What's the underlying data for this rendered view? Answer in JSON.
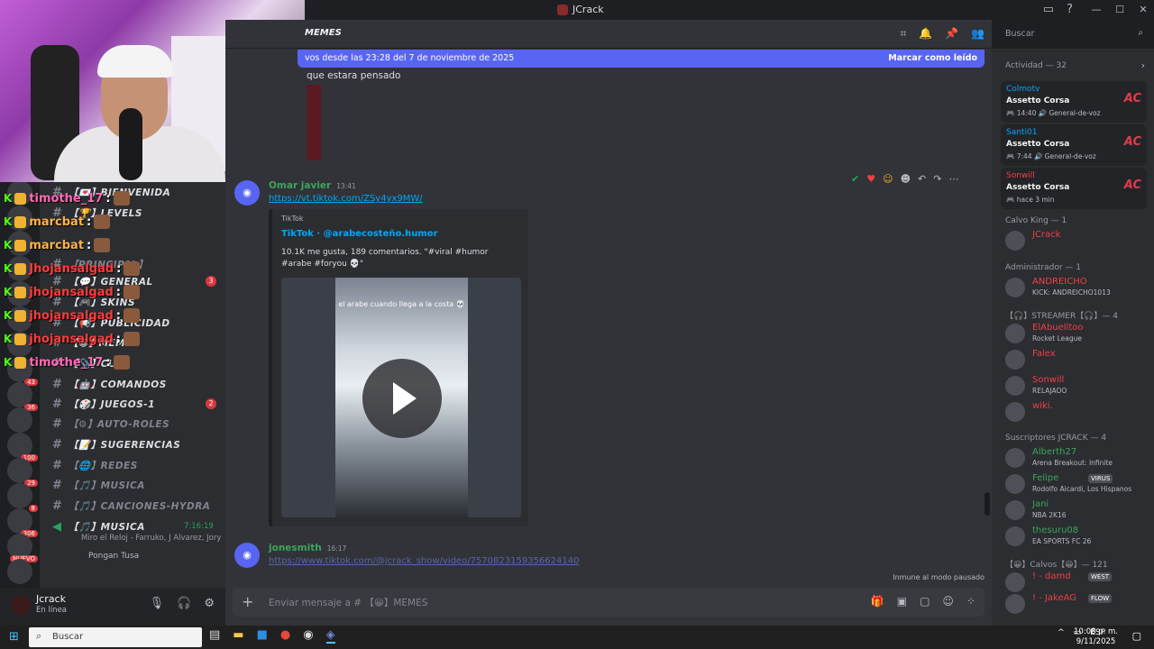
{
  "window": {
    "title": "JCrack"
  },
  "titlebar_icons": [
    "monitor-icon",
    "help-icon"
  ],
  "channel_header": {
    "name": "MEMES"
  },
  "new_messages_bar": {
    "text": "vos desde las 23:28 del 7 de noviembre de 2025",
    "action": "Marcar como leído"
  },
  "messages": [
    {
      "text": "que estara pensado"
    },
    {
      "author": "Omar javier",
      "author_color": "#3ba55c",
      "time": "13:41",
      "link": "https://vt.tiktok.com/ZSy4yx9MW/",
      "embed": {
        "provider": "TikTok",
        "title": "TikTok · @arabecosteño.humor",
        "description": "10.1K me gusta, 189 comentarios. \"#viral #humor #arabe #foryou 💀\"",
        "video_caption": "el arabe cuando llega a la costa 💀"
      }
    },
    {
      "author": "jonesmith",
      "author_color": "#3ba55c",
      "time": "16:17",
      "link": "https://www.tiktok.com/@jcrack_show/video/7570823159356624140"
    }
  ],
  "slowmode_text": "Inmune al modo pausado",
  "composer": {
    "placeholder": "Enviar mensaje a # 【😀】MEMES"
  },
  "channels": [
    {
      "name": "【💌】BIENVENIDA",
      "dim": false
    },
    {
      "name": "【🏆】LEVELS",
      "dim": false
    },
    {
      "name": "【PRINCIPAL】",
      "dim": true
    },
    {
      "name": "【💬】GENERAL",
      "dim": false,
      "badge": "3"
    },
    {
      "name": "【🎮】SKINS",
      "dim": false
    },
    {
      "name": "【📢】PUBLICIDAD",
      "dim": false
    },
    {
      "name": "【😀】MEMES",
      "dim": false
    },
    {
      "name": "【📎】CL",
      "dim": false
    },
    {
      "name": "【🤖】COMANDOS",
      "dim": false
    },
    {
      "name": "【🎲】JUEGOS-1",
      "dim": false,
      "badge": "2"
    },
    {
      "name": "【⚙】AUTO-ROLES",
      "dim": true
    },
    {
      "name": "【📝】SUGERENCIAS",
      "dim": false
    },
    {
      "name": "【🌐】REDES",
      "dim": true
    },
    {
      "name": "【🎵】MUSICA",
      "dim": true
    },
    {
      "name": "【🎵】CANCIONES-HYDRA",
      "dim": true
    },
    {
      "name": "【🎵】MUSICA",
      "dim": false,
      "voice": true,
      "timer": "7:16:19"
    }
  ],
  "voice_status": {
    "now_playing": "Miro el Reloj - Farruko, J Alvarez, Jory",
    "user": "Pongan Tusa"
  },
  "rail_badges": [
    "43",
    "36",
    "100",
    "29",
    "8",
    "306",
    "NUEVO"
  ],
  "chat_overlay": [
    {
      "name": "timothe_17",
      "color": "#ff69b4"
    },
    {
      "name": "marcbat",
      "color": "#ffb347"
    },
    {
      "name": "marcbat",
      "color": "#ffb347"
    },
    {
      "name": "Jhojansalgad",
      "color": "#ff3b3b"
    },
    {
      "name": "jhojansalgad",
      "color": "#ff3b3b"
    },
    {
      "name": "jhojansalgad",
      "color": "#ff3b3b"
    },
    {
      "name": "jhojansalgad",
      "color": "#ff3b3b"
    },
    {
      "name": "timothe_17",
      "color": "#ff69b4"
    }
  ],
  "user_panel": {
    "name": "Jcrack",
    "status": "En línea"
  },
  "search": {
    "placeholder": "Buscar"
  },
  "activity": {
    "header": "Actividad — 32",
    "items": [
      {
        "user": "Colmotv",
        "color": "#00a8fc",
        "game": "Assetto Corsa",
        "meta": "🎮 14:40  🔊 General-de-voz"
      },
      {
        "user": "Santi01",
        "color": "#00a8fc",
        "game": "Assetto Corsa",
        "meta": "🎮 7:44  🔊 General-de-voz"
      },
      {
        "user": "Sonwill",
        "color": "#f23f43",
        "game": "Assetto Corsa",
        "meta": "🎮 hace 3 min"
      }
    ],
    "logo_text": "AC"
  },
  "member_groups": [
    {
      "label": "Calvo King — 1",
      "members": [
        {
          "name": "JCrack",
          "color": "#f23f43",
          "status": ""
        }
      ]
    },
    {
      "label": "Administrador — 1",
      "members": [
        {
          "name": "ANDREICHO",
          "color": "#f23f43",
          "status": "KICK: ANDREICHO1013"
        }
      ]
    },
    {
      "label": "【🎧】STREAMER【🎧】— 4",
      "members": [
        {
          "name": "ElAbuelitoo",
          "color": "#f23f43",
          "status": "Rocket League"
        },
        {
          "name": "Falex",
          "color": "#f23f43",
          "status": ""
        },
        {
          "name": "Sonwill",
          "color": "#f23f43",
          "status": "RELAJAOO"
        },
        {
          "name": "wiki.",
          "color": "#f23f43",
          "status": ""
        }
      ]
    },
    {
      "label": "Suscriptores JCRACK — 4",
      "members": [
        {
          "name": "Alberth27",
          "color": "#3ba55c",
          "status": "Arena Breakout: Infinite"
        },
        {
          "name": "Felipe",
          "color": "#3ba55c",
          "status": "Rodolfo Aicardi, Los Hispanos",
          "tag": "VIRUS"
        },
        {
          "name": "Jani",
          "color": "#3ba55c",
          "status": "NBA 2K16"
        },
        {
          "name": "thesuru08",
          "color": "#3ba55c",
          "status": "EA SPORTS FC 26"
        }
      ]
    },
    {
      "label": "【😀】Calvos【😀】— 121",
      "members": [
        {
          "name": "! - damd",
          "color": "#f23f43",
          "status": "",
          "tag": "WEST"
        },
        {
          "name": "! - JakeAG",
          "color": "#f23f43",
          "status": "",
          "tag": "FLOW"
        }
      ]
    }
  ],
  "taskbar": {
    "search": "Buscar",
    "lang": "ESP",
    "time": "10:08 p. m.",
    "date": "9/11/2025"
  }
}
